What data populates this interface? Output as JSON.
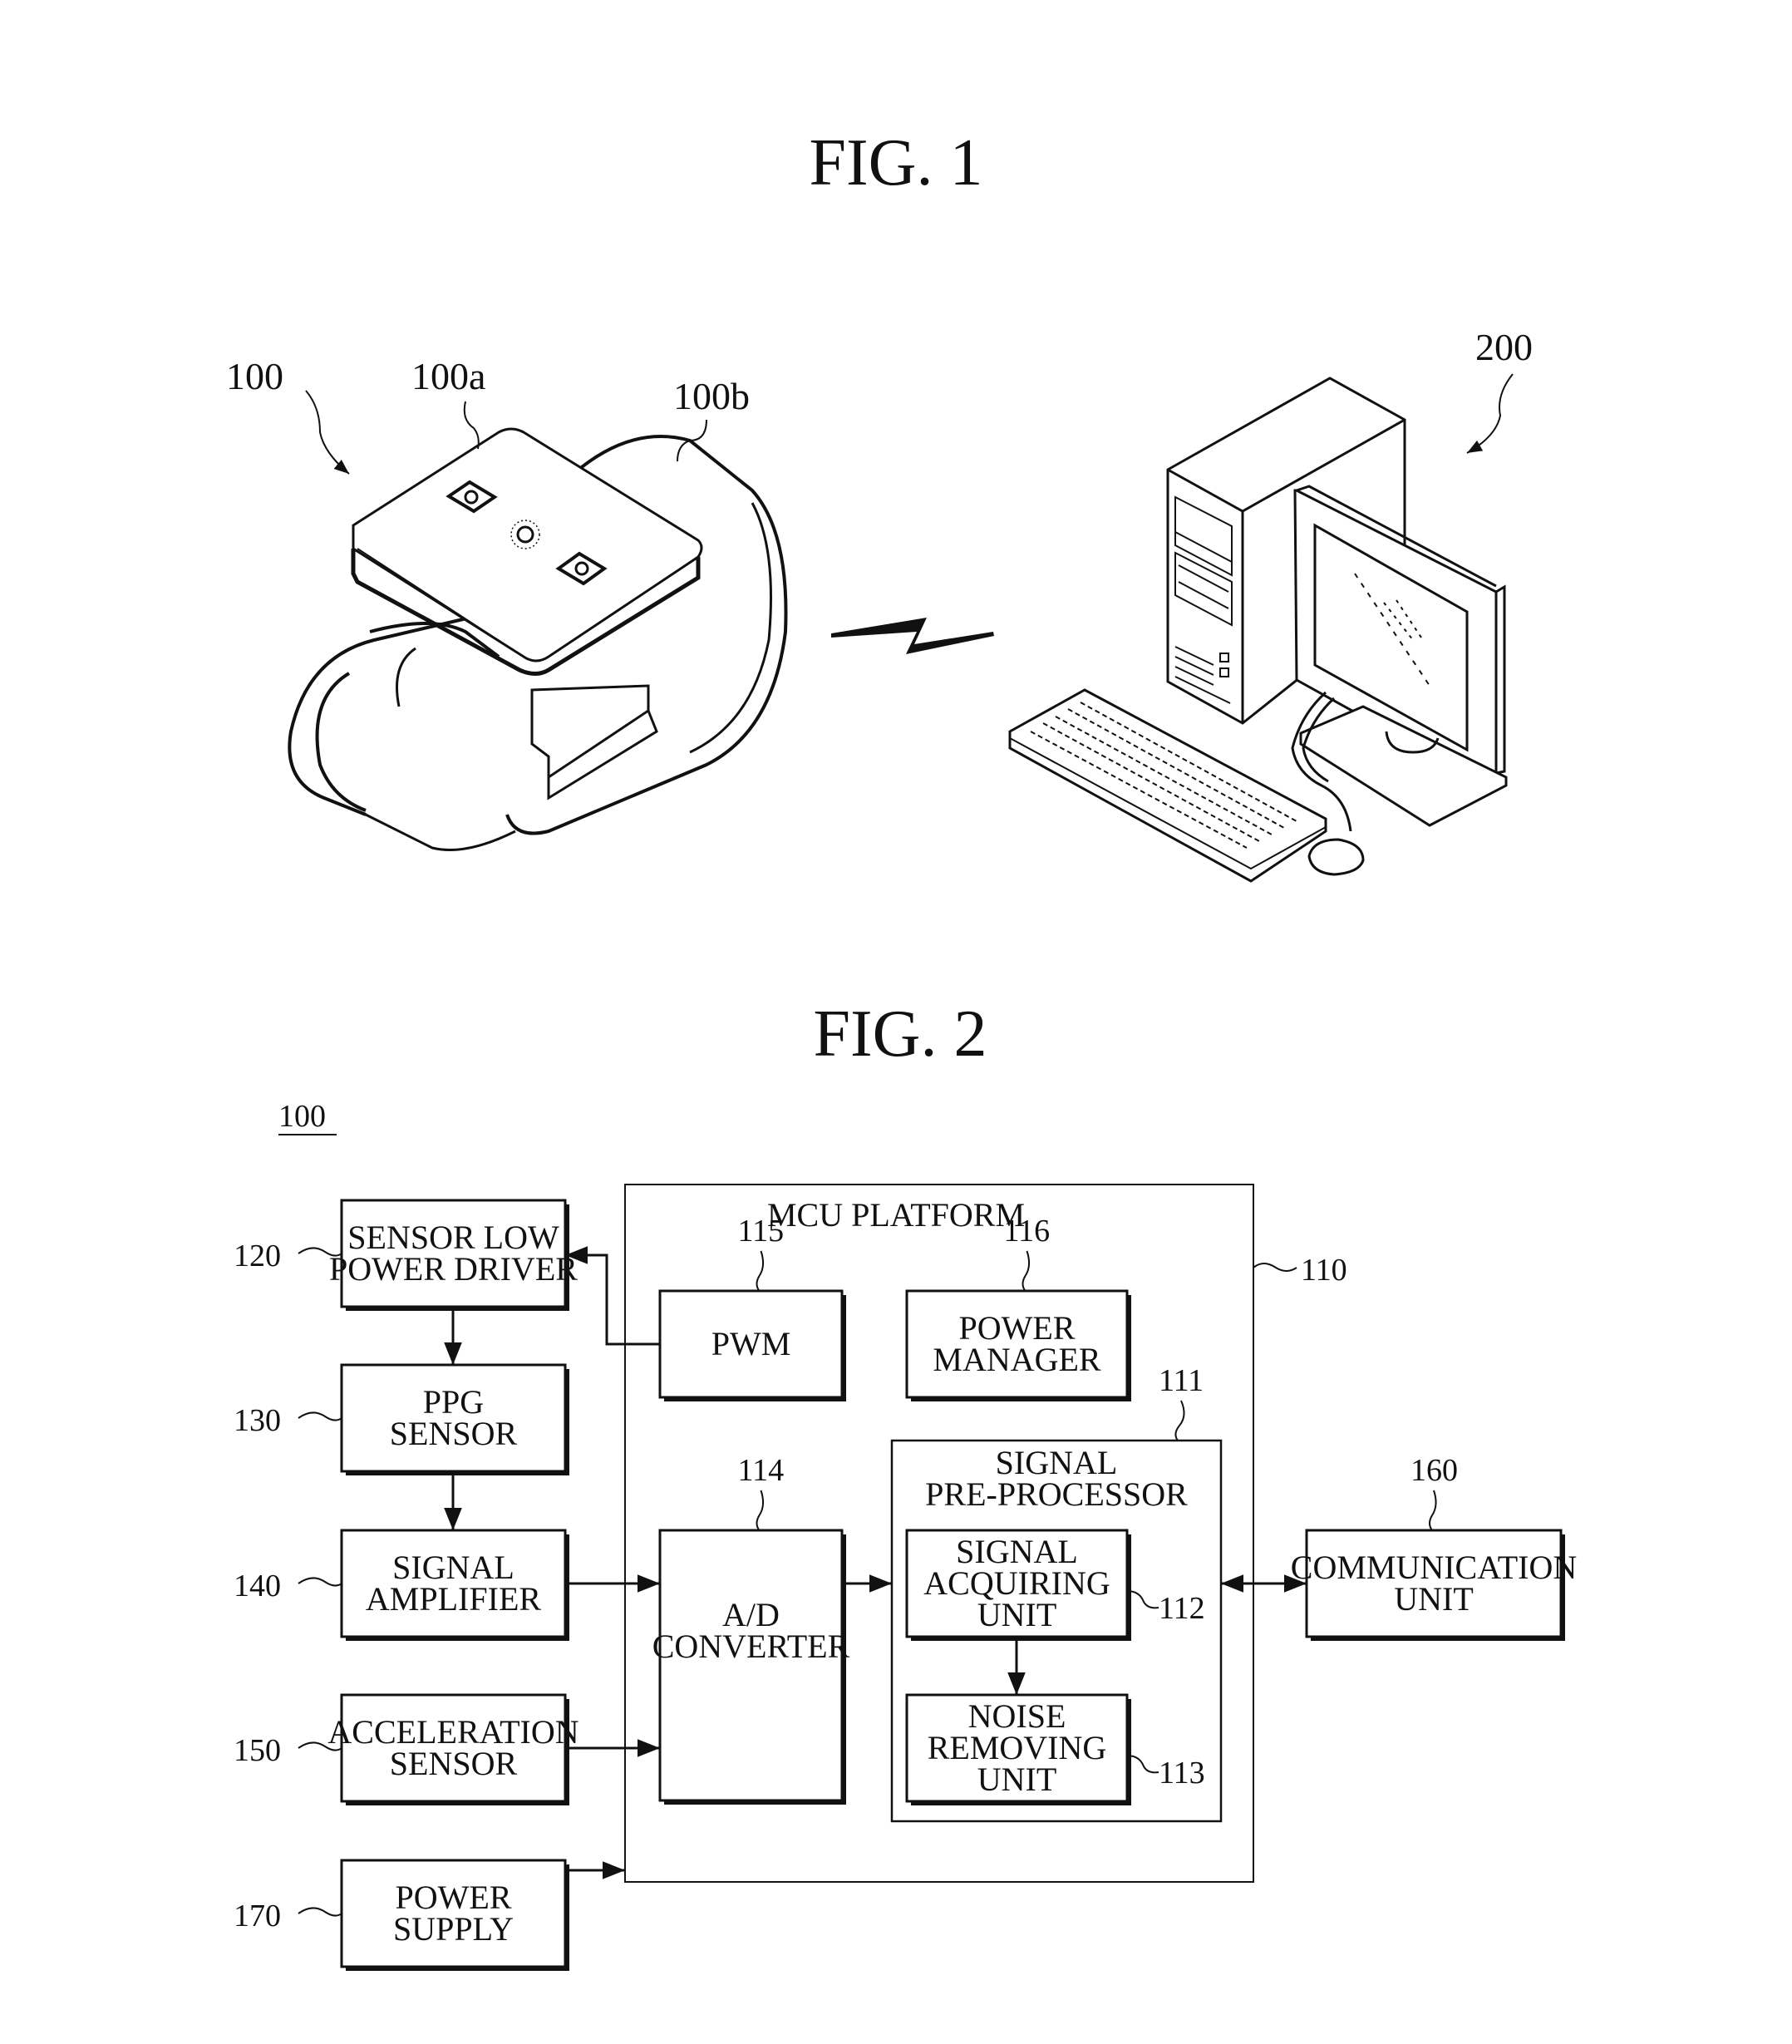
{
  "figure1": {
    "title": "FIG. 1",
    "labels": {
      "device": "100",
      "device_body": "100a",
      "device_band": "100b",
      "computer": "200"
    },
    "icons": {
      "wearable": "wristband-device-icon",
      "wireless": "wireless-link-icon",
      "computer": "desktop-computer-icon"
    }
  },
  "figure2": {
    "title": "FIG. 2",
    "system_ref": "100",
    "mcu": {
      "label": "MCU PLATFORM",
      "ref": "110"
    },
    "blocks": {
      "sensor_driver": {
        "lines": [
          "SENSOR LOW",
          "POWER DRIVER"
        ],
        "ref": "120"
      },
      "ppg_sensor": {
        "lines": [
          "PPG",
          "SENSOR"
        ],
        "ref": "130"
      },
      "signal_amplifier": {
        "lines": [
          "SIGNAL",
          "AMPLIFIER"
        ],
        "ref": "140"
      },
      "acceleration_sensor": {
        "lines": [
          "ACCELERATION",
          "SENSOR"
        ],
        "ref": "150"
      },
      "power_supply": {
        "lines": [
          "POWER",
          "SUPPLY"
        ],
        "ref": "170"
      },
      "pwm": {
        "lines": [
          "PWM"
        ],
        "ref": "115"
      },
      "power_manager": {
        "lines": [
          "POWER",
          "MANAGER"
        ],
        "ref": "116"
      },
      "ad_converter": {
        "lines": [
          "A/D",
          "CONVERTER"
        ],
        "ref": "114"
      },
      "signal_preprocessor": {
        "lines": [
          "SIGNAL",
          "PRE-PROCESSOR"
        ],
        "ref": "111"
      },
      "signal_acquiring": {
        "lines": [
          "SIGNAL",
          "ACQUIRING",
          "UNIT"
        ],
        "ref": "112"
      },
      "noise_removing": {
        "lines": [
          "NOISE",
          "REMOVING",
          "UNIT"
        ],
        "ref": "113"
      },
      "communication": {
        "lines": [
          "COMMUNICATION",
          "UNIT"
        ],
        "ref": "160"
      }
    },
    "connections": [
      {
        "from": "pwm",
        "to": "sensor_driver"
      },
      {
        "from": "sensor_driver",
        "to": "ppg_sensor"
      },
      {
        "from": "ppg_sensor",
        "to": "signal_amplifier"
      },
      {
        "from": "signal_amplifier",
        "to": "ad_converter"
      },
      {
        "from": "acceleration_sensor",
        "to": "ad_converter"
      },
      {
        "from": "ad_converter",
        "to": "signal_preprocessor"
      },
      {
        "from": "signal_acquiring",
        "to": "noise_removing"
      },
      {
        "from": "signal_preprocessor",
        "to": "communication",
        "bidirectional": true
      },
      {
        "from": "power_supply",
        "to": "mcu"
      }
    ]
  }
}
